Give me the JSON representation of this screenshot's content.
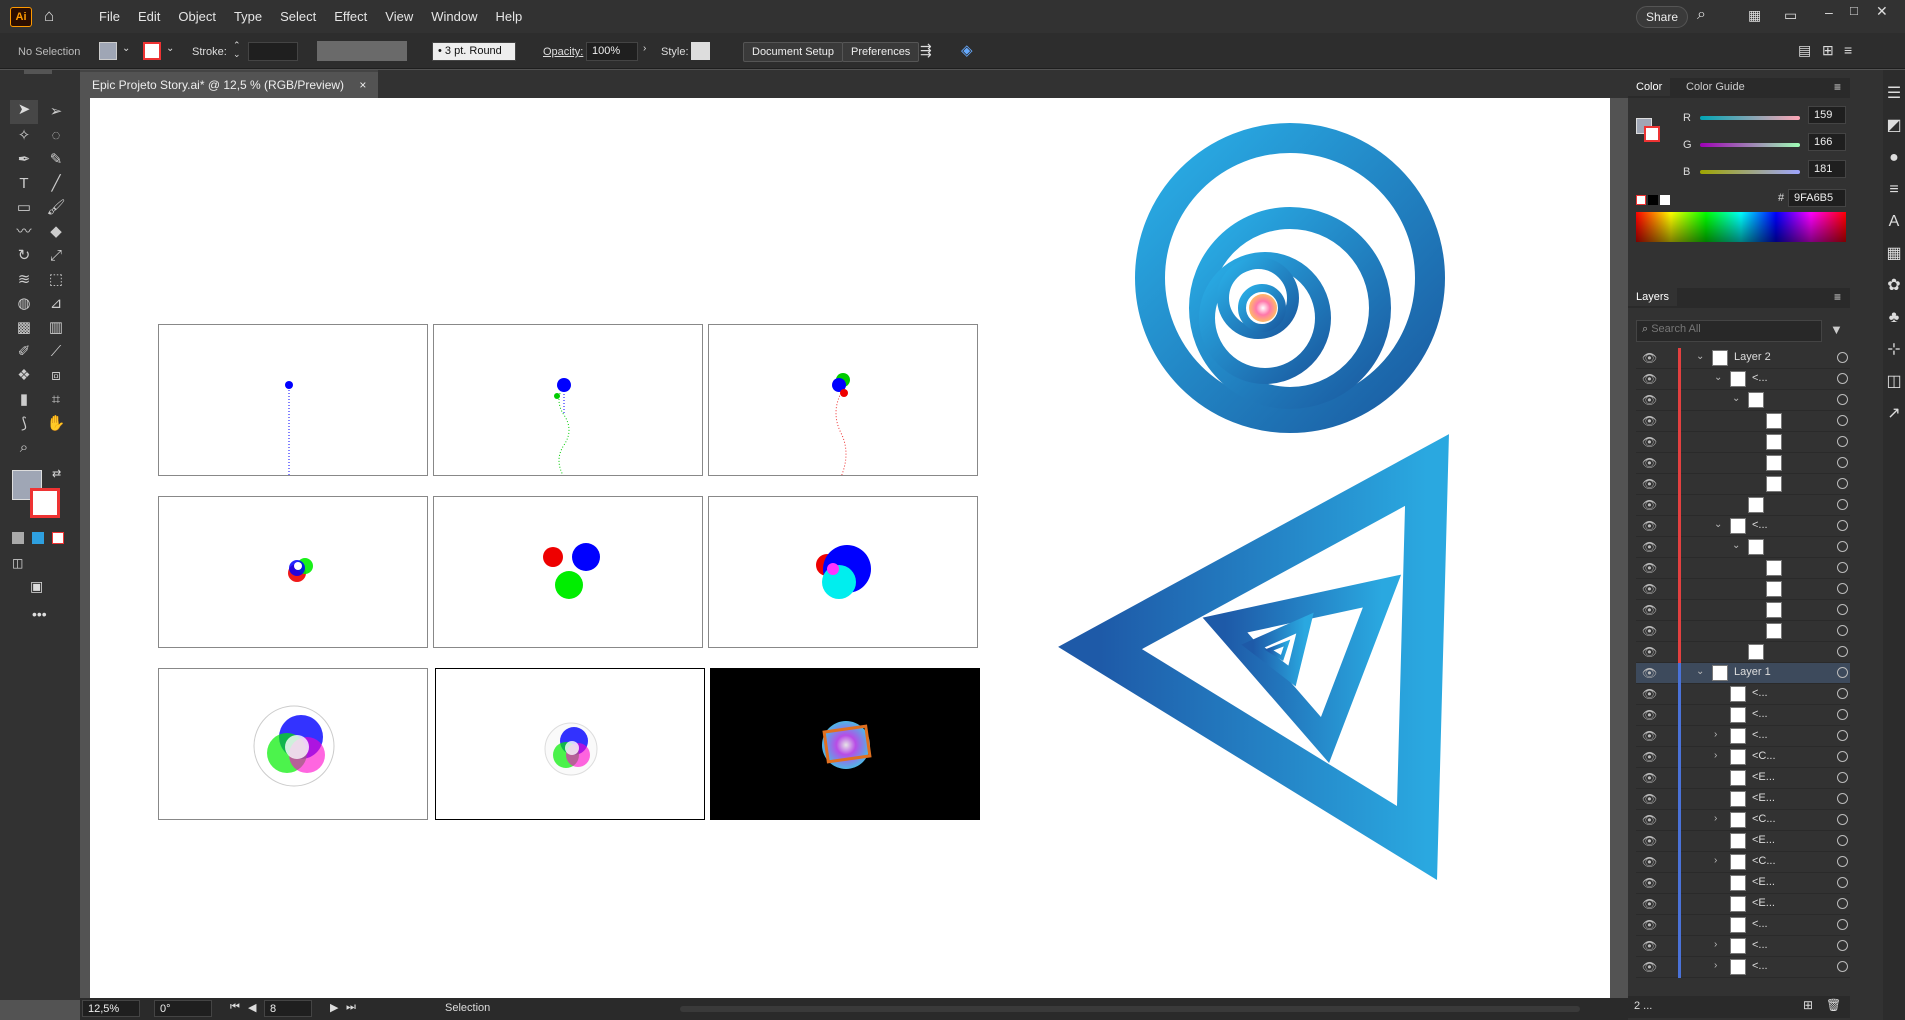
{
  "app": {
    "logo": "Ai",
    "home_icon": "home-icon"
  },
  "menu": [
    "File",
    "Edit",
    "Object",
    "Type",
    "Select",
    "Effect",
    "View",
    "Window",
    "Help"
  ],
  "topright": {
    "share": "Share"
  },
  "control": {
    "selection": "No Selection",
    "stroke_label": "Stroke:",
    "brush": "3 pt. Round",
    "opacity_label": "Opacity:",
    "opacity": "100%",
    "style_label": "Style:",
    "doc_setup": "Document Setup",
    "preferences": "Preferences"
  },
  "document": {
    "tab": "Epic Projeto Story.ai* @ 12,5 % (RGB/Preview)",
    "close": "×"
  },
  "canvas_shapes": {
    "fill": "#9FA6B5"
  },
  "color_panel": {
    "tabs": [
      "Color",
      "Color Guide"
    ],
    "r_label": "R",
    "g_label": "G",
    "b_label": "B",
    "r": "159",
    "g": "166",
    "b": "181",
    "hex_label": "#",
    "hex": "9FA6B5"
  },
  "layers_panel": {
    "title": "Layers",
    "search_placeholder": "Search All",
    "rows": [
      {
        "name": "Layer 2",
        "indent": 0,
        "color": "#e34040",
        "chev": "v"
      },
      {
        "name": "<...",
        "indent": 1,
        "color": "#e34040",
        "chev": "v"
      },
      {
        "name": "",
        "indent": 2,
        "color": "#e34040",
        "chev": "v"
      },
      {
        "name": "",
        "indent": 3,
        "color": "#e34040",
        "chev": ""
      },
      {
        "name": "",
        "indent": 3,
        "color": "#e34040",
        "chev": ""
      },
      {
        "name": "",
        "indent": 3,
        "color": "#e34040",
        "chev": ""
      },
      {
        "name": "",
        "indent": 3,
        "color": "#e34040",
        "chev": ""
      },
      {
        "name": "",
        "indent": 2,
        "color": "#e34040",
        "chev": ""
      },
      {
        "name": "<...",
        "indent": 1,
        "color": "#e34040",
        "chev": "v"
      },
      {
        "name": "",
        "indent": 2,
        "color": "#e34040",
        "chev": "v"
      },
      {
        "name": "",
        "indent": 3,
        "color": "#e34040",
        "chev": ""
      },
      {
        "name": "",
        "indent": 3,
        "color": "#e34040",
        "chev": ""
      },
      {
        "name": "",
        "indent": 3,
        "color": "#e34040",
        "chev": ""
      },
      {
        "name": "",
        "indent": 3,
        "color": "#e34040",
        "chev": ""
      },
      {
        "name": "",
        "indent": 2,
        "color": "#e34040",
        "chev": ""
      },
      {
        "name": "Layer 1",
        "indent": 0,
        "color": "#4a72d8",
        "chev": "v"
      },
      {
        "name": "<...",
        "indent": 1,
        "color": "#4a72d8",
        "chev": ""
      },
      {
        "name": "<...",
        "indent": 1,
        "color": "#4a72d8",
        "chev": ""
      },
      {
        "name": "<...",
        "indent": 1,
        "color": "#4a72d8",
        "chev": ">"
      },
      {
        "name": "<C...",
        "indent": 1,
        "color": "#4a72d8",
        "chev": ">"
      },
      {
        "name": "<E...",
        "indent": 1,
        "color": "#4a72d8",
        "chev": ""
      },
      {
        "name": "<E...",
        "indent": 1,
        "color": "#4a72d8",
        "chev": ""
      },
      {
        "name": "<C...",
        "indent": 1,
        "color": "#4a72d8",
        "chev": ">"
      },
      {
        "name": "<E...",
        "indent": 1,
        "color": "#4a72d8",
        "chev": ""
      },
      {
        "name": "<C...",
        "indent": 1,
        "color": "#4a72d8",
        "chev": ">"
      },
      {
        "name": "<E...",
        "indent": 1,
        "color": "#4a72d8",
        "chev": ""
      },
      {
        "name": "<E...",
        "indent": 1,
        "color": "#4a72d8",
        "chev": ""
      },
      {
        "name": "<...",
        "indent": 1,
        "color": "#4a72d8",
        "chev": ""
      },
      {
        "name": "<...",
        "indent": 1,
        "color": "#4a72d8",
        "chev": ">"
      },
      {
        "name": "<...",
        "indent": 1,
        "color": "#4a72d8",
        "chev": ">"
      }
    ],
    "footer_count": "2 ..."
  },
  "status": {
    "zoom": "12,5%",
    "rotation": "0°",
    "artboard": "8",
    "tool": "Selection"
  }
}
